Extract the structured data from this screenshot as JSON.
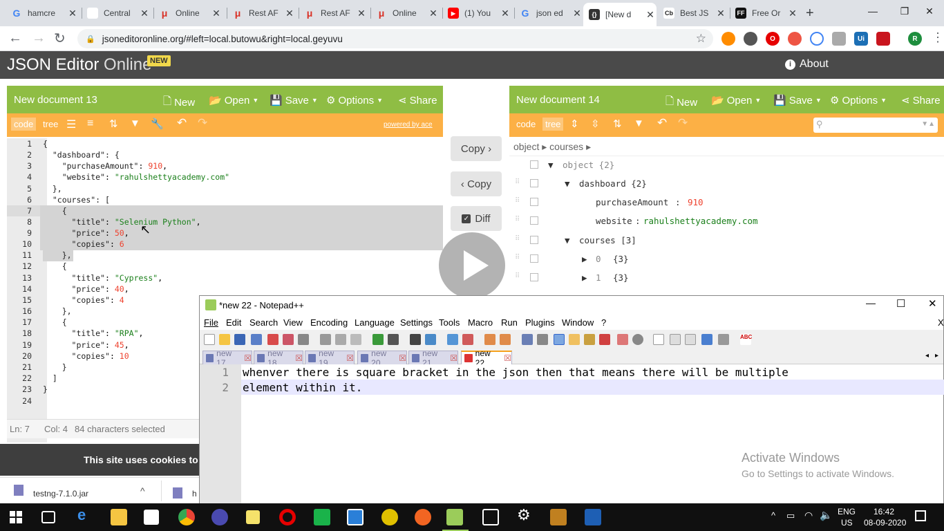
{
  "browser": {
    "tabs": [
      {
        "label": "hamcre",
        "icon": "G",
        "color": "#4285f4"
      },
      {
        "label": "Central",
        "icon": "",
        "color": "#999"
      },
      {
        "label": "Online",
        "icon": "μ",
        "color": "#d93025"
      },
      {
        "label": "Rest AF",
        "icon": "μ",
        "color": "#d93025"
      },
      {
        "label": "Rest AF",
        "icon": "μ",
        "color": "#d93025"
      },
      {
        "label": "Online",
        "icon": "μ",
        "color": "#d93025"
      },
      {
        "label": "(1) You",
        "icon": "▶",
        "color": "#ff0000"
      },
      {
        "label": "json ed",
        "icon": "G",
        "color": "#4285f4"
      },
      {
        "label": "[New d",
        "icon": "{}",
        "color": "#333"
      },
      {
        "label": "Best JS",
        "icon": "Cb",
        "color": "#222"
      },
      {
        "label": "Free Or",
        "icon": "FF",
        "color": "#111"
      }
    ],
    "url": "jsoneditoronline.org/#left=local.butowu&right=local.geyuvu"
  },
  "app": {
    "title_main": "JSON Editor",
    "title_sub": "Online",
    "badge": "NEW",
    "about": "About"
  },
  "left_panel": {
    "doc_name": "New document 13",
    "menu": {
      "new": "New",
      "open": "Open",
      "save": "Save",
      "options": "Options",
      "share": "Share"
    },
    "modes": {
      "code": "code",
      "tree": "tree"
    },
    "powered_by": "powered by ace",
    "line_numbers": [
      "1",
      "2",
      "3",
      "4",
      "5",
      "6",
      "7",
      "8",
      "9",
      "10",
      "11",
      "12",
      "13",
      "14",
      "15",
      "16",
      "17",
      "18",
      "19",
      "20",
      "21",
      "22",
      "23",
      "24"
    ],
    "status": {
      "ln": "Ln: 7",
      "col": "Col: 4",
      "selected": "84 characters selected"
    }
  },
  "code": {
    "l1": "{",
    "l2_key": "\"dashboard\"",
    "l2_rest": ": {",
    "l3_key": "\"purchaseAmount\"",
    "l3_val": "910",
    "l4_key": "\"website\"",
    "l4_val": "\"rahulshettyacademy.com\"",
    "l5": "},",
    "l6_key": "\"courses\"",
    "l6_rest": ": [",
    "l7": "{",
    "l8_key": "\"title\"",
    "l8_val": "\"Selenium Python\"",
    "l9_key": "\"price\"",
    "l9_val": "50",
    "l10_key": "\"copies\"",
    "l10_val": "6",
    "l11": "},",
    "l12": "{",
    "l13_key": "\"title\"",
    "l13_val": "\"Cypress\"",
    "l14_key": "\"price\"",
    "l14_val": "40",
    "l15_key": "\"copies\"",
    "l15_val": "4",
    "l16": "},",
    "l17": "{",
    "l18_key": "\"title\"",
    "l18_val": "\"RPA\"",
    "l19_key": "\"price\"",
    "l19_val": "45",
    "l20_key": "\"copies\"",
    "l20_val": "10",
    "l21": "}",
    "l22": "]",
    "l23": "}"
  },
  "middle": {
    "copy_right": "Copy ›",
    "copy_left": "‹ Copy",
    "diff": "Diff"
  },
  "right_panel": {
    "doc_name": "New document 14",
    "menu": {
      "new": "New",
      "open": "Open",
      "save": "Save",
      "options": "Options",
      "share": "Share"
    },
    "modes": {
      "code": "code",
      "tree": "tree"
    },
    "breadcrumb": "object ▸ courses ▸",
    "tree": {
      "root": "object {2}",
      "dashboard": "dashboard {2}",
      "purchase_key": "purchaseAmount",
      "purchase_val": "910",
      "website_key": "website",
      "website_val": "rahulshettyacademy.com",
      "courses": "courses [3]",
      "item0_idx": "0",
      "item0_count": "{3}",
      "item1_idx": "1",
      "item1_count": "{3}"
    }
  },
  "cookie_banner": "This site uses cookies to",
  "downloads": {
    "file": "testng-7.1.0.jar",
    "file2": "h"
  },
  "notepad": {
    "title": "*new 22 - Notepad++",
    "menu": [
      "File",
      "Edit",
      "Search",
      "View",
      "Encoding",
      "Language",
      "Settings",
      "Tools",
      "Macro",
      "Run",
      "Plugins",
      "Window",
      "?"
    ],
    "menu_close": "X",
    "tabs": [
      "new 17",
      "new 18",
      "new 19",
      "new 20",
      "new 21",
      "new 22"
    ],
    "lines": [
      {
        "no": "1",
        "text": "whenver there is square bracket in the json then that means there will be multiple"
      },
      {
        "no": "2",
        "text": "element within it."
      }
    ]
  },
  "watermark": {
    "title": "Activate Windows",
    "sub": "Go to Settings to activate Windows."
  },
  "taskbar": {
    "lang1": "ENG",
    "lang2": "US",
    "time": "16:42",
    "date": "08-09-2020"
  }
}
